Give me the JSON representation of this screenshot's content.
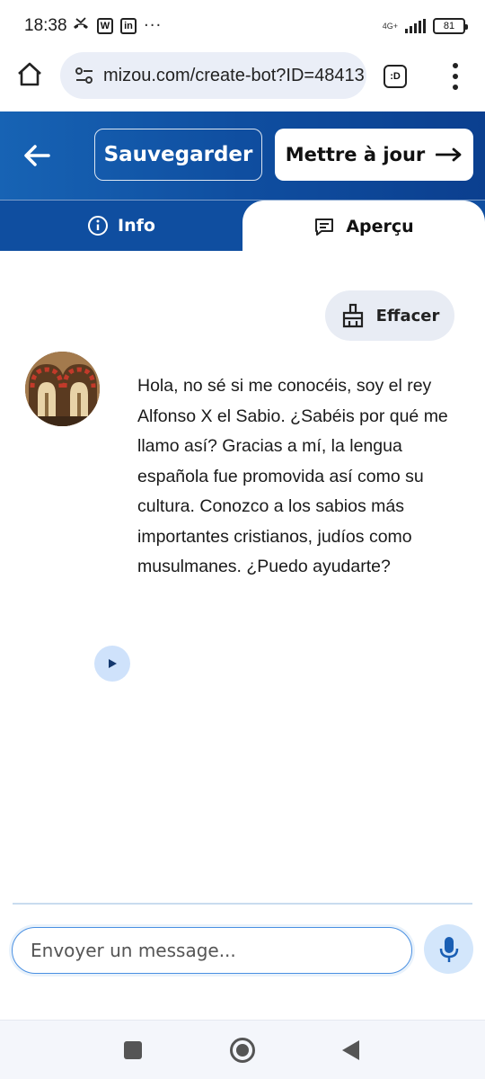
{
  "status_bar": {
    "time": "18:38",
    "missed_call_icon": "missed-call-icon",
    "app_icon_1": "W",
    "app_icon_2": "in",
    "more": "···",
    "network": "4G+",
    "battery": "81"
  },
  "browser": {
    "url": "mizou.com/create-bot?ID=48413",
    "tab_label": ":D"
  },
  "header": {
    "save_label": "Sauvegarder",
    "update_label": "Mettre à jour"
  },
  "tabs": {
    "info_label": "Info",
    "preview_label": "Aperçu",
    "active": "preview"
  },
  "chat": {
    "clear_label": "Effacer",
    "bot_message": "Hola, no sé si me conocéis, soy el rey Alfonso X el Sabio. ¿Sabéis por qué me llamo así? Gracias a mí, la lengua española fue promovida así como su cultura. Conozco a los sabios más importantes cristianos, judíos como musulmanes. ¿Puedo ayudarte?"
  },
  "composer": {
    "placeholder": "Envoyer un message..."
  },
  "colors": {
    "header_blue": "#0f4ea0",
    "accent_light": "#d3e6fb",
    "input_border": "#4a90e2"
  }
}
